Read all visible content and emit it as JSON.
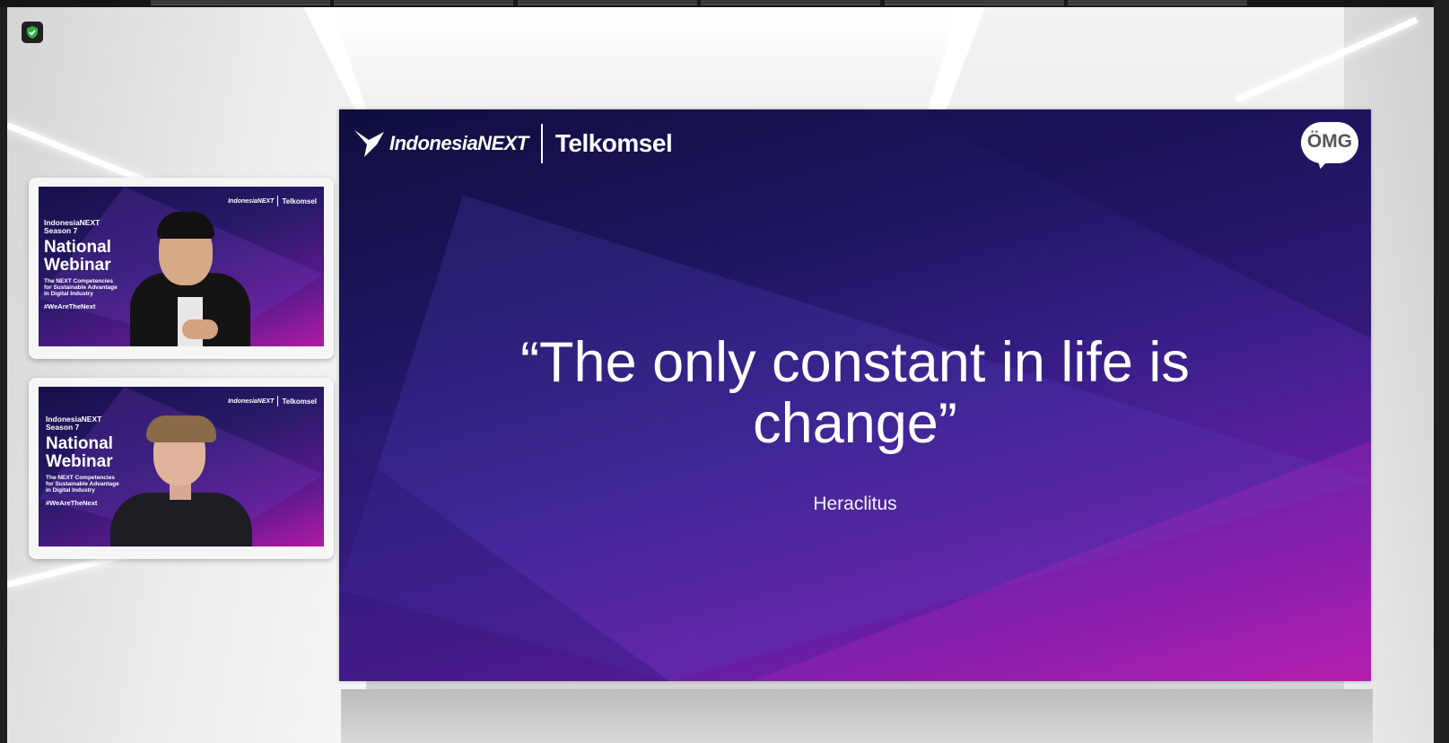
{
  "security": {
    "icon": "shield-check-icon",
    "color": "#2fae4a"
  },
  "participants": [
    {
      "brand": "IndonesiaNEXT",
      "partner": "Telkomsel",
      "event_line1": "IndonesiaNEXT",
      "event_line2": "Season 7",
      "title_line1": "National",
      "title_line2": "Webinar",
      "desc_line1": "The NEXT Competencies",
      "desc_line2": "for Sustainable Advantage",
      "desc_line3": "in Digital Industry",
      "hashtag": "#WeAreTheNext"
    },
    {
      "brand": "IndonesiaNEXT",
      "partner": "Telkomsel",
      "event_line1": "IndonesiaNEXT",
      "event_line2": "Season 7",
      "title_line1": "National",
      "title_line2": "Webinar",
      "desc_line1": "The NEXT Competencies",
      "desc_line2": "for Sustainable Advantage",
      "desc_line3": "in Digital Industry",
      "hashtag": "#WeAreTheNext"
    }
  ],
  "slide": {
    "brand": "IndonesiaNEXT",
    "partner": "Telkomsel",
    "corner_logo": "ÖMG",
    "quote_line1": "“The only constant in life is",
    "quote_line2": "change”",
    "author": "Heraclitus"
  }
}
